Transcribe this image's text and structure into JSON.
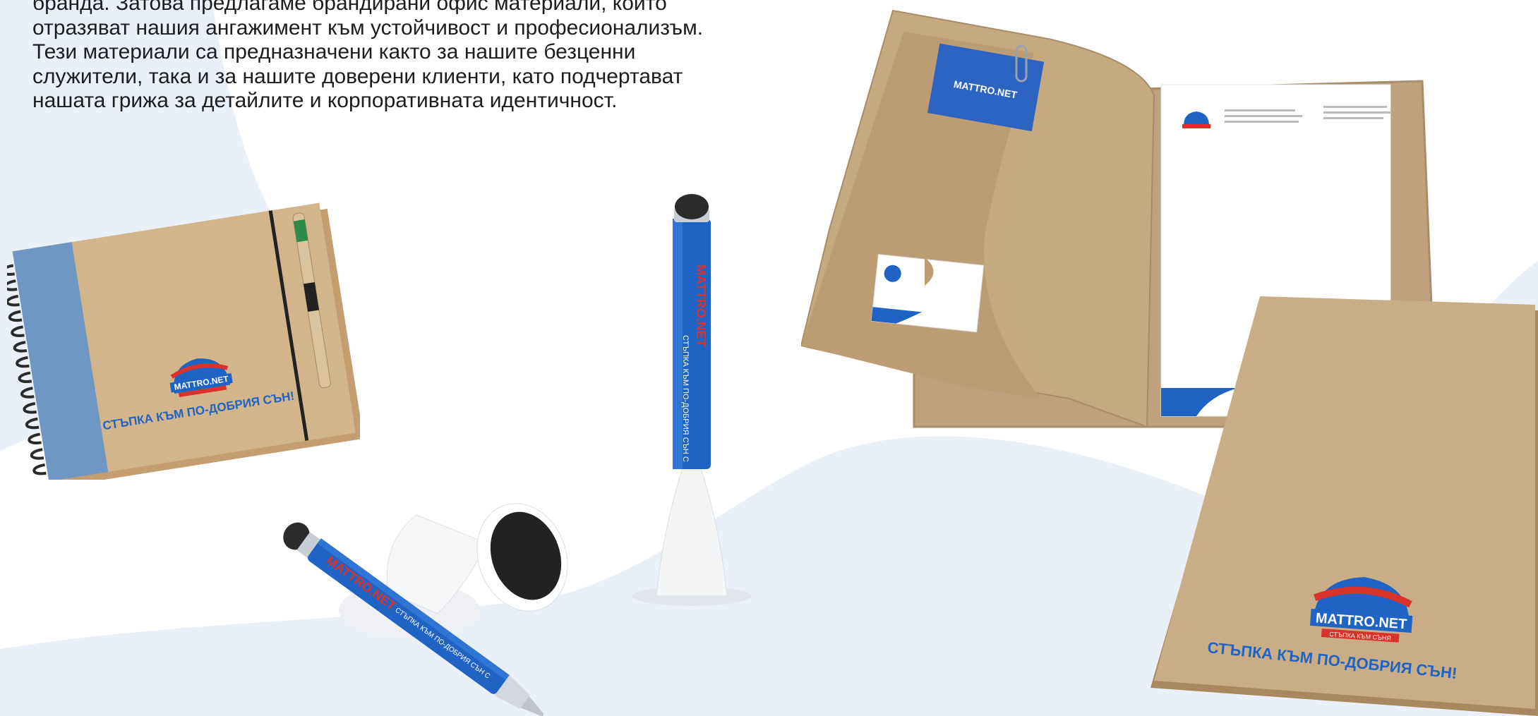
{
  "intro": {
    "lines": [
      "бранда. Затова предлагаме брандирани офис материали, които",
      "отразяват нашия ангажимент към устойчивост и професионализъм.",
      "Тези материали са предназначени както за нашите безценни",
      "служители, така и за нашите доверени клиенти, като подчертават",
      "нашата грижа за детайлите и корпоративната идентичност."
    ]
  },
  "brand": {
    "logo_text": "MATTRO.NET",
    "logo_sub": "СТЪПКА КЪМ СЪНЯ",
    "slogan": "СТЪПКА КЪМ ПО-ДОБРИЯ СЪН!",
    "pen_text": "СТЪПКА КЪМ ПО-ДОБРИЯ СЪН С",
    "colors": {
      "blue": "#1f63c4",
      "red": "#d8322a",
      "kraft": "#c9ad86",
      "background_wave": "#eaf0f8"
    }
  }
}
